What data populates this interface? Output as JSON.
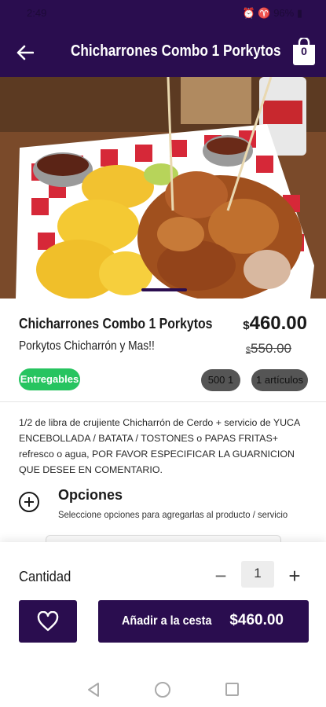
{
  "status_bar": {
    "time": "2:49",
    "indicators": "⏰ ♈ 96% ▮"
  },
  "app_bar": {
    "back_icon": "arrow-left-icon",
    "title": "Chicharrones Combo 1 Porkytos",
    "cart_icon": "cart-icon",
    "cart_count": "0"
  },
  "product": {
    "image_alt": "Foto de chicharrones con tostones",
    "name": "Chicharrones Combo 1 Porkytos",
    "subtitle": "Porkytos Chicharrón y Mas!!",
    "currency": "$",
    "price": "460.00",
    "old_price": "550.00",
    "badge": "Entregables",
    "chip_qty": "500 1",
    "chip_items": "1 artículos",
    "description": "1/2 de libra de crujiente Chicharrón de Cerdo + servicio de YUCA ENCEBOLLADA / BATATA / TOSTONES o PAPAS FRITAS+ refresco o agua, POR FAVOR ESPECIFICAR LA GUARNICION QUE DESEE EN COMENTARIO."
  },
  "options": {
    "title": "Opciones",
    "subtitle": "Seleccione opciones para agregarlas al producto / servicio",
    "icon": "plus-circle-icon"
  },
  "quantity": {
    "label": "Cantidad",
    "minus": "−",
    "value": "1",
    "plus": "+"
  },
  "actions": {
    "favorite_icon": "heart-icon",
    "add_label": "Añadir a la cesta",
    "add_price": "$460.00"
  },
  "nav": {
    "back_icon": "triangle-back-icon",
    "home_icon": "circle-home-icon",
    "recent_icon": "square-recent-icon"
  },
  "colors": {
    "primary": "#2a0d4f",
    "badge_green": "#27c460",
    "chip_grey": "#555555"
  }
}
